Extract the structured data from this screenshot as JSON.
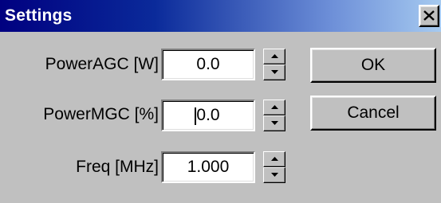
{
  "window": {
    "title": "Settings",
    "close_glyph": "×",
    "titlebar_gradient": [
      "#000080",
      "#a6caf0"
    ],
    "background": "#c0c0c0"
  },
  "fields": {
    "power_agc": {
      "label": "PowerAGC [W]",
      "value": "0.0"
    },
    "power_mgc": {
      "label": "PowerMGC [%]",
      "value": "0.0"
    },
    "freq": {
      "label": "Freq [MHz]",
      "value": "1.000"
    }
  },
  "buttons": {
    "ok_label": "OK",
    "cancel_label": "Cancel"
  },
  "icons": {
    "close": "close-icon",
    "spin_up": "arrow-up-icon",
    "spin_down": "arrow-down-icon"
  }
}
